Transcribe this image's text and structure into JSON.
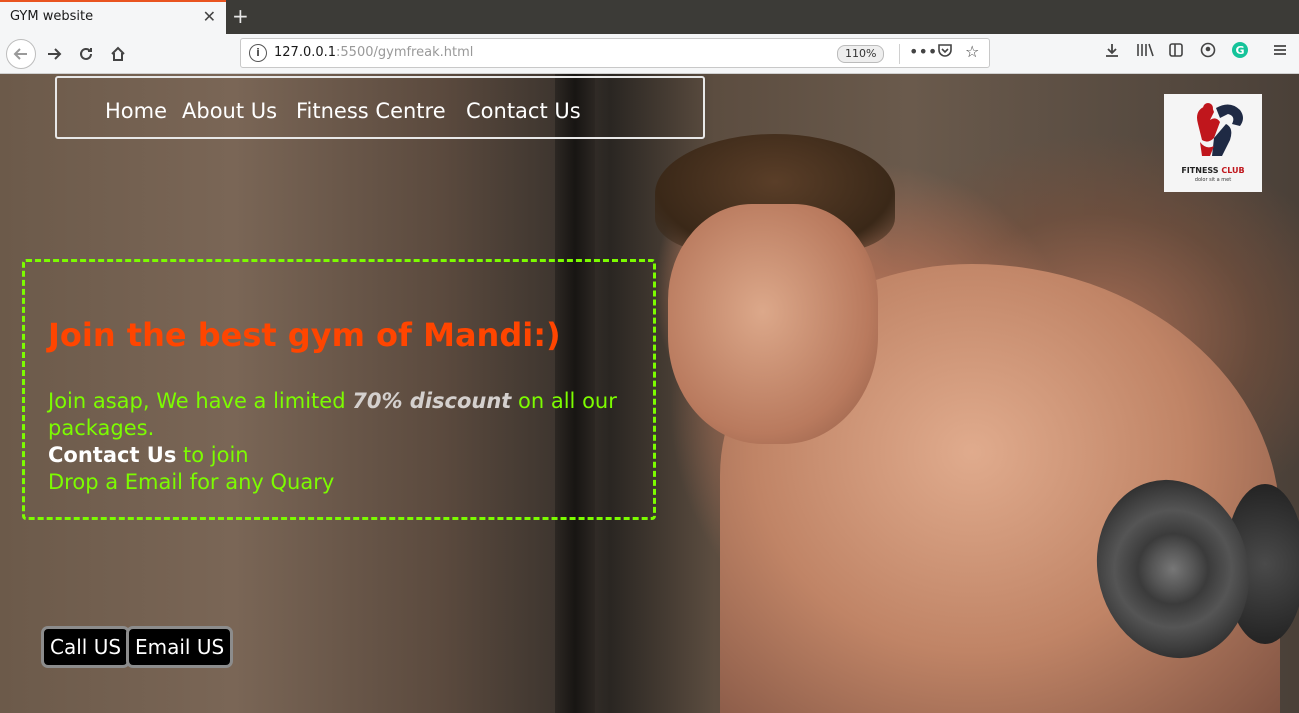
{
  "browser": {
    "tab_title": "GYM website",
    "tab_close": "✕",
    "new_tab": "+",
    "url_host": "127.0.0.1",
    "url_rest": ":5500/gymfreak.html",
    "zoom": "110%"
  },
  "nav": {
    "items": [
      {
        "label": "Home"
      },
      {
        "label": "About Us"
      },
      {
        "label": "Fitness Centre"
      },
      {
        "label": "Contact Us"
      }
    ]
  },
  "logo": {
    "brand": "FITNESS",
    "brand2": "CLUB",
    "tagline": "dolor sit a met"
  },
  "promo": {
    "title": "Join the best gym of Mandi:)",
    "line1_start": "Join asap, We have a limited ",
    "discount": "70% discount",
    "line1_end": " on all our packages.",
    "contact_bold": "Contact Us",
    "contact_rest": " to join",
    "line3": "Drop a Email for any Quary"
  },
  "buttons": {
    "call": "Call US",
    "email": "Email US"
  },
  "colors": {
    "promo_title": "#ff4500",
    "promo_text": "#7cfc00",
    "promo_border": "#7cfc00",
    "discount_text": "#d4d0ce",
    "tab_accent": "#e95420"
  }
}
